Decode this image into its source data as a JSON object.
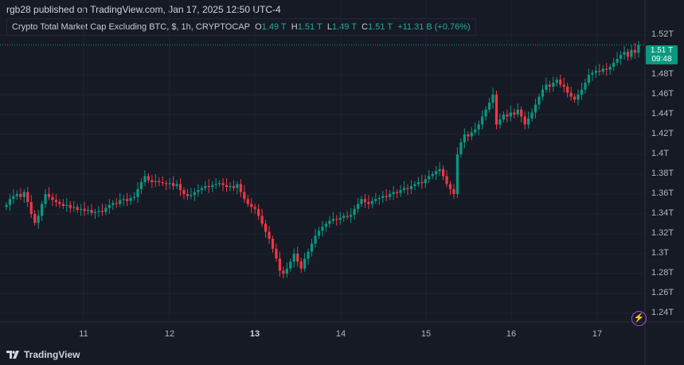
{
  "header": {
    "published": "rgb28 published on TradingView.com, Jan 17, 2025 12:50 UTC-4"
  },
  "legend": {
    "symbol": "Crypto Total Market Cap Excluding BTC, $, 1h, CRYPTOCAP",
    "o_label": "O",
    "o": "1.49 T",
    "h_label": "H",
    "h": "1.51 T",
    "l_label": "L",
    "l": "1.49 T",
    "c_label": "C",
    "c": "1.51 T",
    "change": "+11.31 B (+0.76%)"
  },
  "price_label": {
    "price": "1.51 T",
    "countdown": "09:48"
  },
  "footer": {
    "brand": "TradingView"
  },
  "colors": {
    "up": "#089981",
    "down": "#f23645",
    "background": "#161a25",
    "grid": "#1f2333"
  },
  "chart_data": {
    "type": "candlestick",
    "interval": "1h",
    "unit": "T",
    "y_ticks": [
      "1.52T",
      "1.48T",
      "1.46T",
      "1.44T",
      "1.42T",
      "1.4T",
      "1.38T",
      "1.36T",
      "1.34T",
      "1.32T",
      "1.3T",
      "1.28T",
      "1.26T",
      "1.24T"
    ],
    "y_tick_values": [
      1.52,
      1.48,
      1.46,
      1.44,
      1.42,
      1.4,
      1.38,
      1.36,
      1.34,
      1.32,
      1.3,
      1.28,
      1.26,
      1.24
    ],
    "x_ticks": [
      "11",
      "12",
      "13",
      "14",
      "15",
      "16",
      "17"
    ],
    "ylim": [
      1.24,
      1.52
    ],
    "grid": true,
    "close": [
      1.349,
      1.355,
      1.358,
      1.36,
      1.357,
      1.362,
      1.352,
      1.34,
      1.331,
      1.338,
      1.35,
      1.36,
      1.357,
      1.354,
      1.352,
      1.35,
      1.348,
      1.349,
      1.346,
      1.347,
      1.344,
      1.345,
      1.343,
      1.344,
      1.341,
      1.342,
      1.343,
      1.342,
      1.346,
      1.349,
      1.351,
      1.35,
      1.354,
      1.355,
      1.353,
      1.356,
      1.357,
      1.365,
      1.372,
      1.378,
      1.374,
      1.372,
      1.373,
      1.372,
      1.371,
      1.37,
      1.371,
      1.368,
      1.37,
      1.364,
      1.36,
      1.358,
      1.359,
      1.362,
      1.364,
      1.366,
      1.368,
      1.367,
      1.369,
      1.37,
      1.371,
      1.369,
      1.367,
      1.368,
      1.366,
      1.37,
      1.362,
      1.355,
      1.35,
      1.347,
      1.345,
      1.338,
      1.33,
      1.322,
      1.315,
      1.305,
      1.295,
      1.283,
      1.28,
      1.285,
      1.292,
      1.3,
      1.292,
      1.285,
      1.295,
      1.302,
      1.31,
      1.318,
      1.323,
      1.327,
      1.33,
      1.333,
      1.335,
      1.334,
      1.336,
      1.338,
      1.337,
      1.339,
      1.345,
      1.35,
      1.355,
      1.352,
      1.35,
      1.353,
      1.355,
      1.356,
      1.358,
      1.357,
      1.36,
      1.362,
      1.361,
      1.364,
      1.366,
      1.365,
      1.368,
      1.37,
      1.372,
      1.371,
      1.375,
      1.378,
      1.38,
      1.383,
      1.385,
      1.378,
      1.37,
      1.365,
      1.36,
      1.4,
      1.412,
      1.42,
      1.418,
      1.422,
      1.425,
      1.43,
      1.438,
      1.445,
      1.452,
      1.46,
      1.43,
      1.435,
      1.44,
      1.438,
      1.442,
      1.44,
      1.445,
      1.438,
      1.43,
      1.436,
      1.442,
      1.45,
      1.458,
      1.465,
      1.47,
      1.468,
      1.472,
      1.475,
      1.47,
      1.468,
      1.462,
      1.458,
      1.455,
      1.46,
      1.465,
      1.472,
      1.48,
      1.482,
      1.484,
      1.483,
      1.486,
      1.485,
      1.488,
      1.492,
      1.496,
      1.5,
      1.503,
      1.498,
      1.505,
      1.502,
      1.51
    ],
    "last_price": 1.51
  }
}
